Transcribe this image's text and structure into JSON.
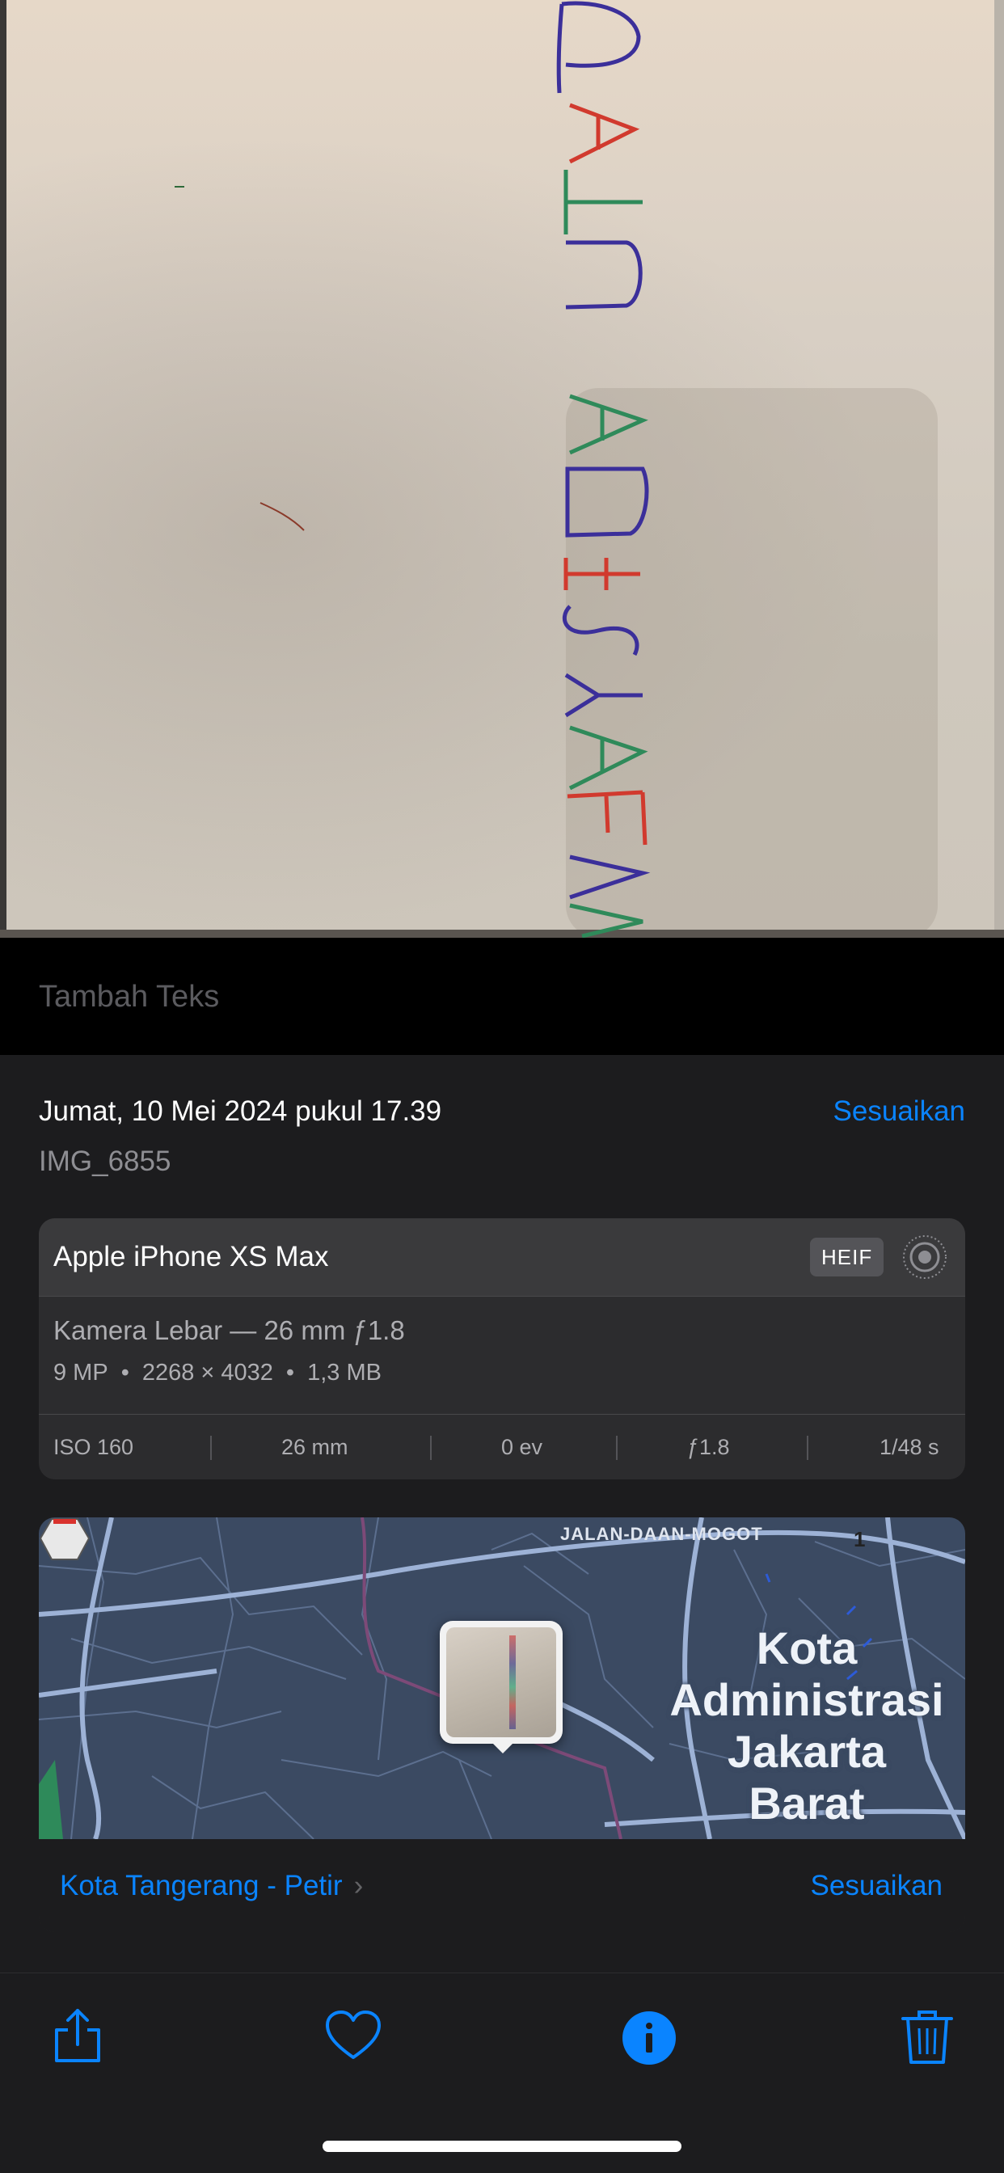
{
  "photo": {
    "handwritten_text": "RATU ADISYA FA"
  },
  "caption": {
    "placeholder": "Tambah Teks"
  },
  "info": {
    "datetime": "Jumat, 10 Mei 2024 pukul 17.39",
    "adjust_label": "Sesuaikan",
    "filename": "IMG_6855"
  },
  "camera": {
    "device": "Apple iPhone XS Max",
    "format_badge": "HEIF",
    "lens": "Kamera Lebar — 26 mm ƒ1.8",
    "megapixels": "9 MP",
    "resolution": "2268 × 4032",
    "filesize": "1,3 MB",
    "exif": {
      "iso": "ISO 160",
      "focal": "26 mm",
      "ev": "0 ev",
      "aperture": "ƒ1.8",
      "shutter": "1/48 s"
    }
  },
  "map": {
    "road_label": "JALAN-DAAN-MOGOT",
    "route_shield": "1",
    "city_label": [
      "Kota",
      "Administrasi",
      "Jakarta",
      "Barat"
    ],
    "location": "Kota Tangerang - Petir",
    "adjust_label": "Sesuaikan"
  },
  "toolbar": {
    "icons": [
      "share-icon",
      "heart-icon",
      "info-icon",
      "trash-icon"
    ]
  },
  "colors": {
    "accent": "#0a84ff",
    "panel_bg": "#1c1c1e",
    "card_bg": "#2c2c2e",
    "map_bg": "#3b4a62"
  }
}
